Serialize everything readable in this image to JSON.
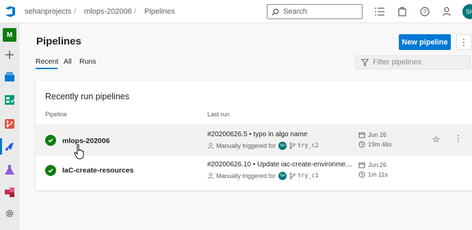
{
  "breadcrumbs": [
    "sehanprojects",
    "mlops-202006",
    "Pipelines"
  ],
  "search": {
    "placeholder": "Search"
  },
  "user": {
    "initials": "SH"
  },
  "rail": {
    "org_letter": "M"
  },
  "page": {
    "title": "Pipelines",
    "new_button": "New pipeline",
    "more": "⋮",
    "tabs": [
      "Recent",
      "All",
      "Runs"
    ],
    "active_tab": "Recent",
    "filter_placeholder": "Filter pipelines"
  },
  "card": {
    "title": "Recently run pipelines",
    "columns": [
      "Pipeline",
      "Last run"
    ],
    "rows": [
      {
        "name": "mlops-202006",
        "run_title": "#20200626.5 • typo in algo name",
        "trigger": "Manually triggered for",
        "avatar": "SH",
        "branch": "try_c2",
        "date": "Jun 26",
        "duration": "19m 46s",
        "status": "succeeded"
      },
      {
        "name": "IaC-create-resources",
        "run_title": "#20200626.10 • Update iac-create-environme…",
        "trigger": "Manually triggered for",
        "avatar": "SH",
        "branch": "try_c1",
        "date": "Jun 26",
        "duration": "1m 11s",
        "status": "succeeded"
      }
    ]
  },
  "colors": {
    "accent": "#0078d4",
    "success": "#107c10",
    "avatar": "#00757a"
  }
}
